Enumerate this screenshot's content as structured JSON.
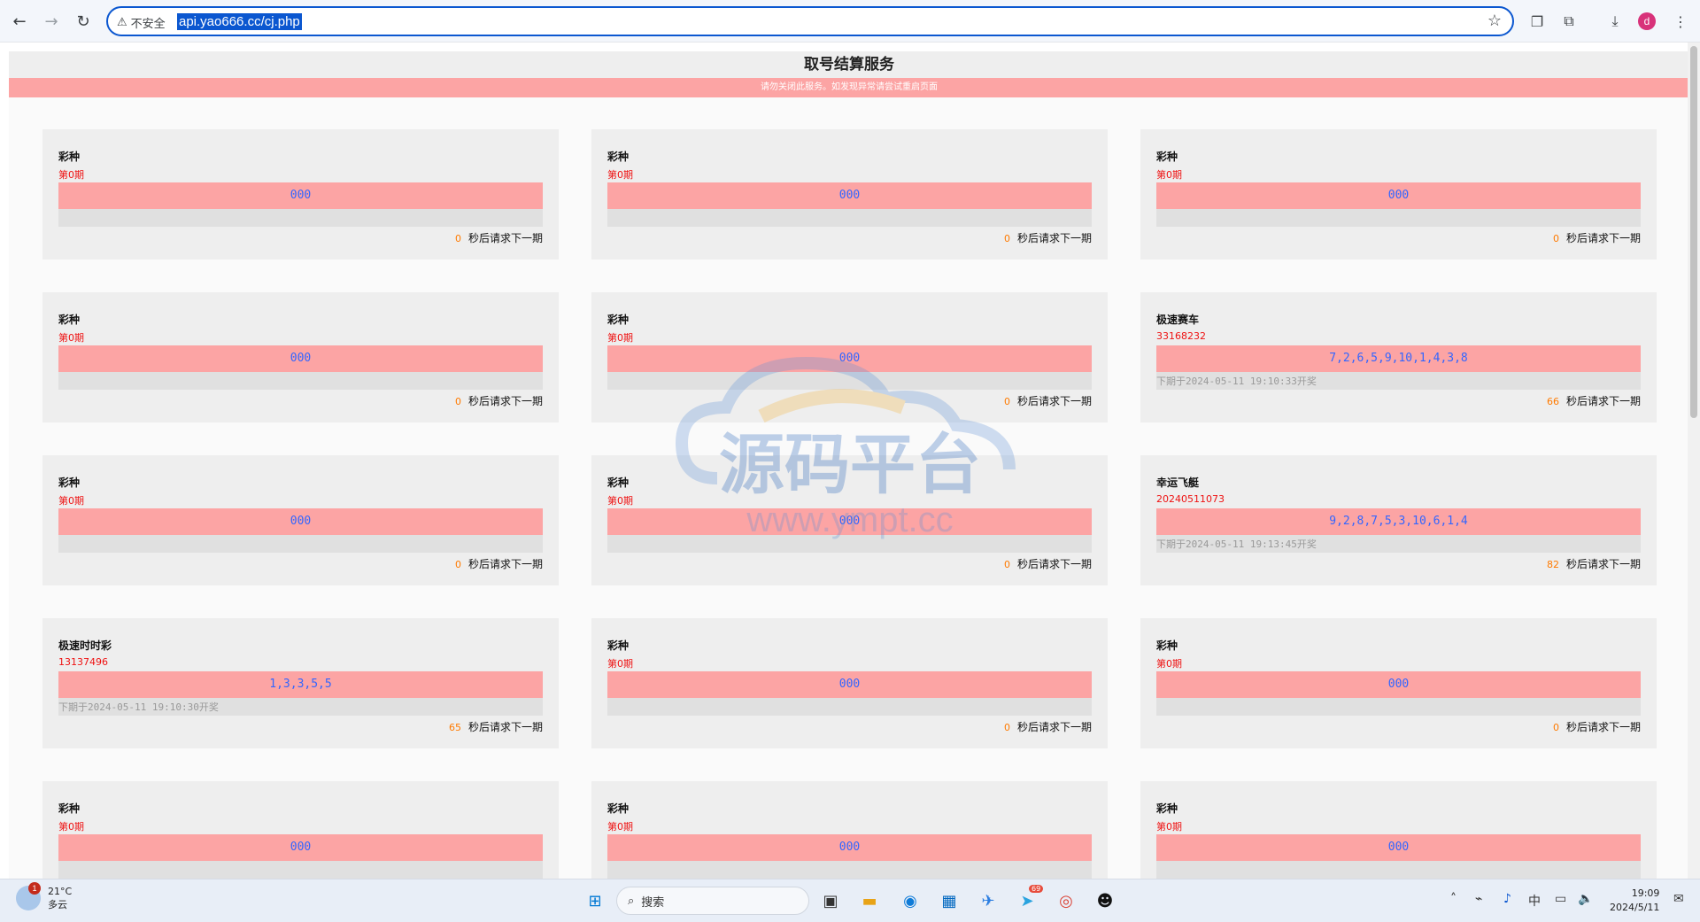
{
  "browser": {
    "security_label": "不安全",
    "url": "api.yao666.cc/cj.php"
  },
  "page": {
    "title": "取号结算服务",
    "notice": "请勿关闭此服务。如发现异常请尝试重启页面"
  },
  "cards": [
    {
      "name": "彩种",
      "issue": "第0期",
      "numbers": "000",
      "next": "",
      "seconds": "0",
      "suffix": "秒后请求下一期"
    },
    {
      "name": "彩种",
      "issue": "第0期",
      "numbers": "000",
      "next": "",
      "seconds": "0",
      "suffix": "秒后请求下一期"
    },
    {
      "name": "彩种",
      "issue": "第0期",
      "numbers": "000",
      "next": "",
      "seconds": "0",
      "suffix": "秒后请求下一期"
    },
    {
      "name": "彩种",
      "issue": "第0期",
      "numbers": "000",
      "next": "",
      "seconds": "0",
      "suffix": "秒后请求下一期"
    },
    {
      "name": "彩种",
      "issue": "第0期",
      "numbers": "000",
      "next": "",
      "seconds": "0",
      "suffix": "秒后请求下一期"
    },
    {
      "name": "极速赛车",
      "issue": "33168232",
      "numbers": "7,2,6,5,9,10,1,4,3,8",
      "next": "下期于2024-05-11 19:10:33开奖",
      "seconds": "66",
      "suffix": "秒后请求下一期"
    },
    {
      "name": "彩种",
      "issue": "第0期",
      "numbers": "000",
      "next": "",
      "seconds": "0",
      "suffix": "秒后请求下一期"
    },
    {
      "name": "彩种",
      "issue": "第0期",
      "numbers": "000",
      "next": "",
      "seconds": "0",
      "suffix": "秒后请求下一期"
    },
    {
      "name": "幸运飞艇",
      "issue": "20240511073",
      "numbers": "9,2,8,7,5,3,10,6,1,4",
      "next": "下期于2024-05-11 19:13:45开奖",
      "seconds": "82",
      "suffix": "秒后请求下一期"
    },
    {
      "name": "极速时时彩",
      "issue": "13137496",
      "numbers": "1,3,3,5,5",
      "next": "下期于2024-05-11 19:10:30开奖",
      "seconds": "65",
      "suffix": "秒后请求下一期"
    },
    {
      "name": "彩种",
      "issue": "第0期",
      "numbers": "000",
      "next": "",
      "seconds": "0",
      "suffix": "秒后请求下一期"
    },
    {
      "name": "彩种",
      "issue": "第0期",
      "numbers": "000",
      "next": "",
      "seconds": "0",
      "suffix": "秒后请求下一期"
    },
    {
      "name": "彩种",
      "issue": "第0期",
      "numbers": "000",
      "next": "",
      "seconds": "",
      "suffix": ""
    },
    {
      "name": "彩种",
      "issue": "第0期",
      "numbers": "000",
      "next": "",
      "seconds": "",
      "suffix": ""
    },
    {
      "name": "彩种",
      "issue": "第0期",
      "numbers": "000",
      "next": "",
      "seconds": "",
      "suffix": ""
    }
  ],
  "watermark": {
    "title": "源码平台",
    "url": "www.ympt.cc"
  },
  "taskbar": {
    "weather_temp": "21°C",
    "weather_desc": "多云",
    "weather_badge": "1",
    "search_label": "搜索",
    "telegram_badge": "69",
    "ime": "中",
    "time": "19:09",
    "date": "2024/5/11"
  },
  "colors": {
    "accent": "#0b57d0",
    "notice_bg": "#fca4a4",
    "numbers_text": "#3366ff",
    "issue_text": "#ee1111",
    "countdown": "#ff7a00"
  }
}
